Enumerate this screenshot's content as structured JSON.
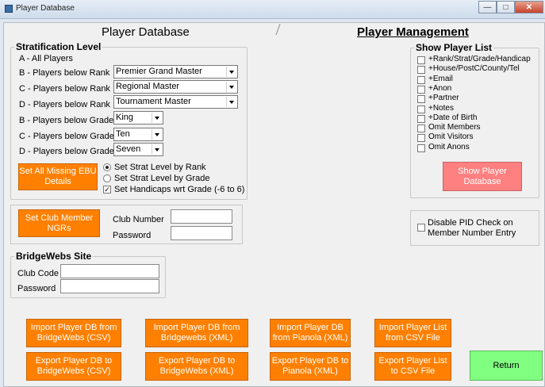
{
  "window": {
    "title": "Player Database"
  },
  "tabs": {
    "left": "Player Database",
    "right": "Player Management"
  },
  "stratification": {
    "legend": "Stratification Level",
    "rows": [
      {
        "label": "A - All Players"
      },
      {
        "label": "B - Players below Rank",
        "value": "Premier Grand Master"
      },
      {
        "label": "C - Players below Rank",
        "value": "Regional Master"
      },
      {
        "label": "D - Players below Rank",
        "value": "Tournament Master"
      },
      {
        "label": "B - Players below Grade",
        "value": "King"
      },
      {
        "label": "C - Players below Grade",
        "value": "Ten"
      },
      {
        "label": "D - Players below Grade",
        "value": "Seven"
      }
    ],
    "set_missing_button": "Set All Missing EBU Details",
    "options": [
      {
        "label": "Set Strat Level by Rank",
        "selected": true
      },
      {
        "label": "Set Strat Level by Grade",
        "selected": false
      },
      {
        "label": "Set Handicaps wrt Grade (-6 to 6)",
        "checked": true
      }
    ]
  },
  "club": {
    "button": "Set Club Member NGRs",
    "number_label": "Club Number",
    "password_label": "Password",
    "number_value": "",
    "password_value": ""
  },
  "bridgewebs": {
    "legend": "BridgeWebs Site",
    "code_label": "Club Code",
    "password_label": "Password",
    "code_value": "",
    "password_value": ""
  },
  "show_list": {
    "legend": "Show Player List",
    "items": [
      {
        "label": "+Rank/Strat/Grade/Handicap",
        "checked": false
      },
      {
        "label": "+House/PostC/County/Tel",
        "checked": false
      },
      {
        "label": "+Email",
        "checked": false
      },
      {
        "label": "+Anon",
        "checked": false
      },
      {
        "label": "+Partner",
        "checked": false
      },
      {
        "label": "+Notes",
        "checked": false
      },
      {
        "label": "+Date of Birth",
        "checked": false
      },
      {
        "label": "Omit Members",
        "checked": false
      },
      {
        "label": "Omit Visitors",
        "checked": false
      },
      {
        "label": "Omit Anons",
        "checked": false
      }
    ],
    "show_button": "Show Player Database"
  },
  "pid_check": {
    "label": "Disable PID Check on Member Number Entry",
    "checked": false
  },
  "actions": {
    "import_bw_csv": "Import Player DB from BridgeWebs (CSV)",
    "import_bw_xml": "Import Player DB from Bridgewebs (XML)",
    "import_pianola": "Import Player DB from Pianola (XML)",
    "import_csv": "Import Player List from CSV File",
    "export_bw_csv": "Export Player DB to BridgeWebs (CSV)",
    "export_bw_xml": "Export Player DB to BridgeWebs (XML)",
    "export_pianola": "Export Player DB to Pianola (XML)",
    "export_csv": "Export Player List to CSV File",
    "return": "Return"
  }
}
